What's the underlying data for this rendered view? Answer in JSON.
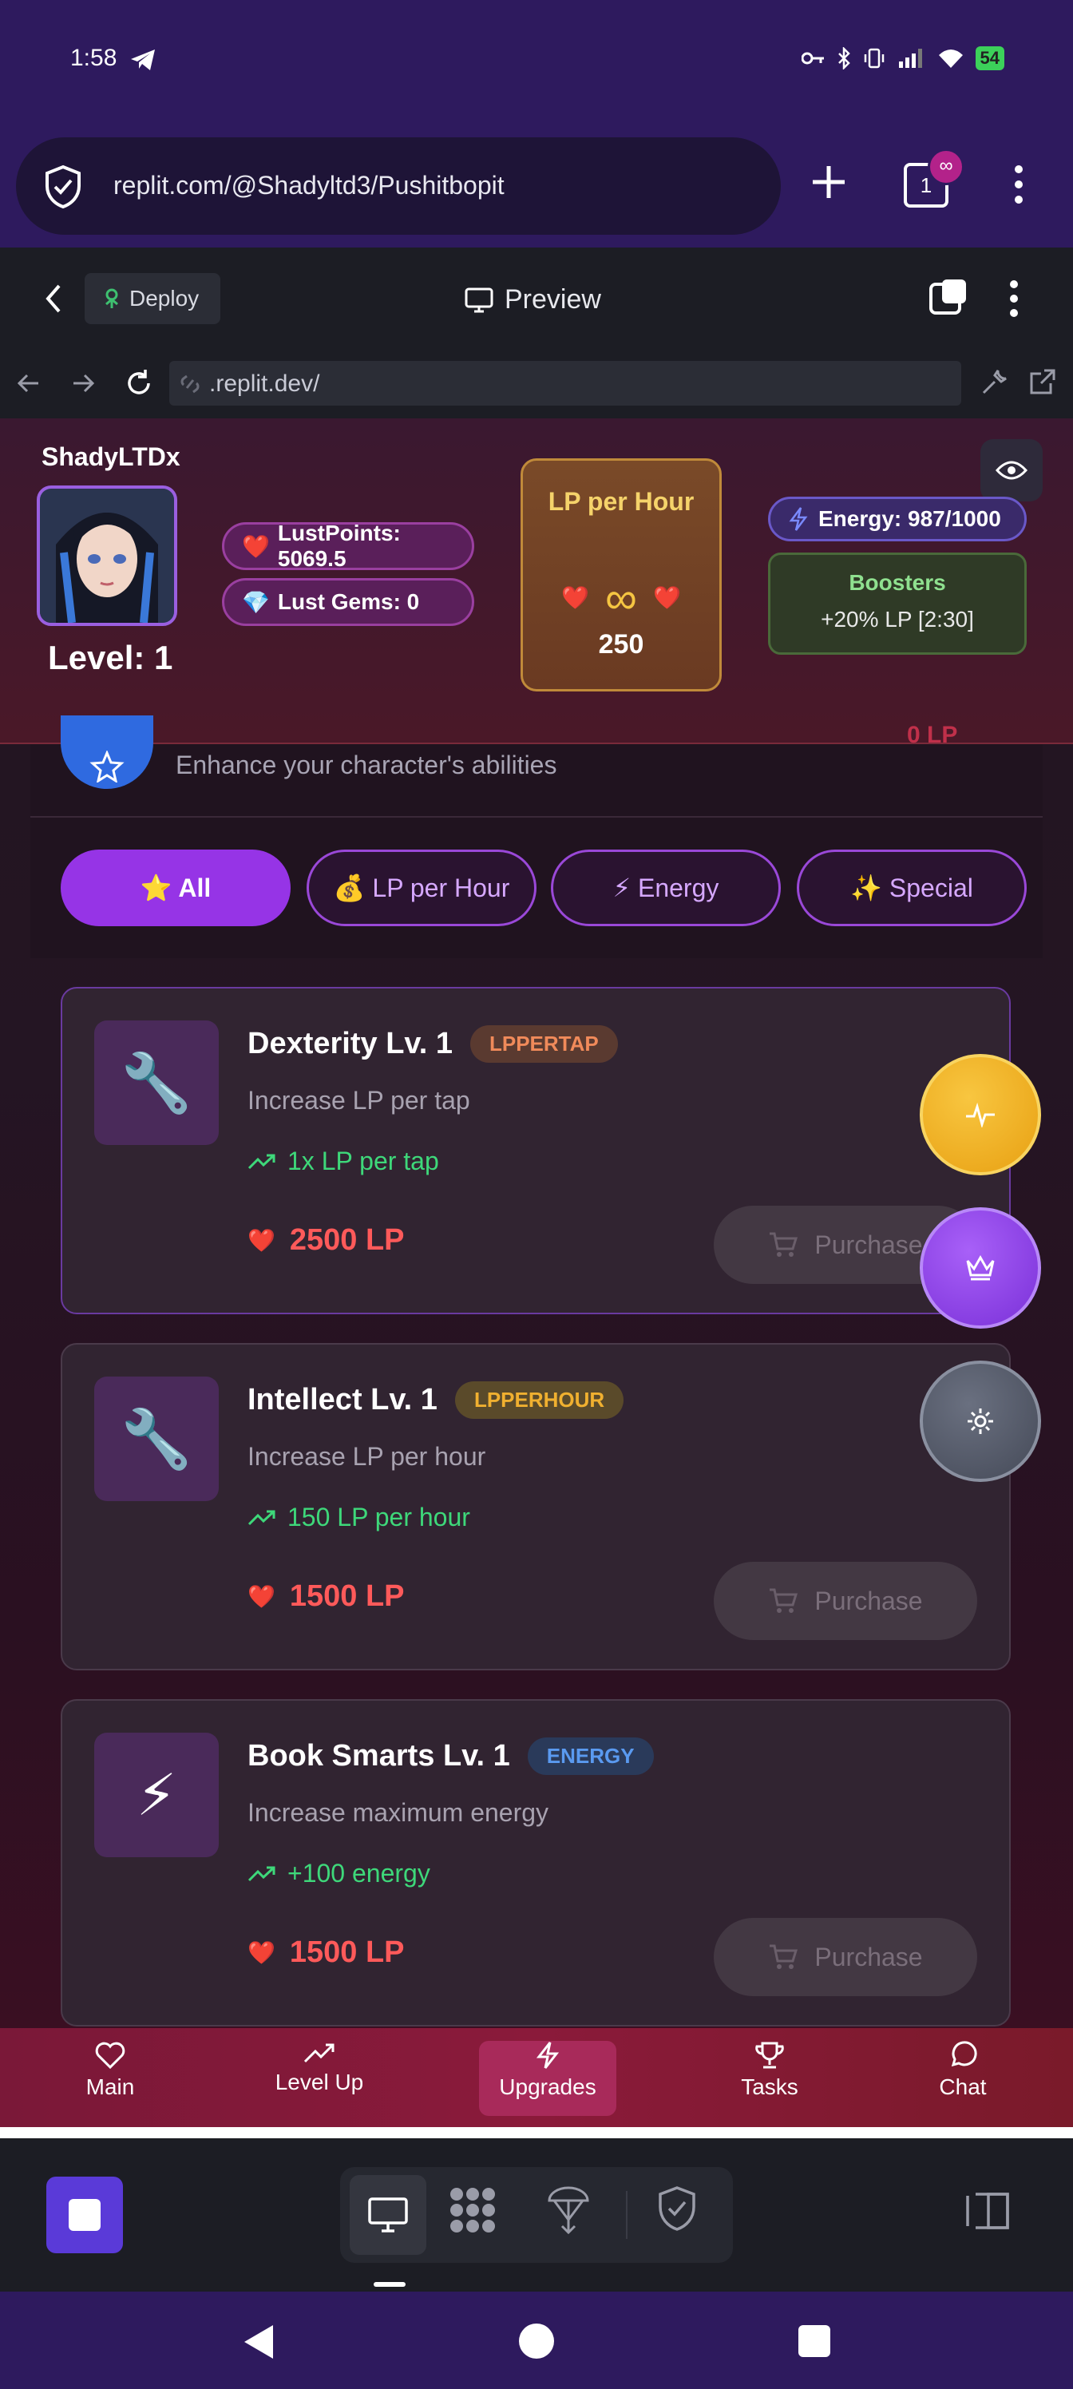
{
  "status_bar": {
    "time": "1:58",
    "battery": "54"
  },
  "browser": {
    "url": "replit.com/@Shadyltd3/Pushitbopit",
    "tab_count": "1",
    "tab_badge": "∞"
  },
  "replit_header": {
    "deploy_label": "Deploy",
    "preview_label": "Preview",
    "address": ".replit.dev/"
  },
  "player": {
    "username": "ShadyLTDx",
    "level": "Level: 1",
    "lust_points": "LustPoints: 5069.5",
    "lust_gems": "Lust Gems: 0",
    "energy": "Energy: 987/1000"
  },
  "lp_per_hour": {
    "title": "LP per Hour",
    "symbol": "∞",
    "value": "250"
  },
  "boosters": {
    "title": "Boosters",
    "value": "+20% LP [2:30]"
  },
  "panel": {
    "subtitle": "Enhance your character's abilities",
    "right": "0 LP"
  },
  "filters": [
    {
      "label": "⭐ All"
    },
    {
      "label": "💰 LP per Hour"
    },
    {
      "label": "⚡ Energy"
    },
    {
      "label": "✨ Special"
    }
  ],
  "upgrades": [
    {
      "icon": "🔧",
      "title": "Dexterity Lv. 1",
      "tag": "LPPERTAP",
      "desc": "Increase LP per tap",
      "effect": "1x LP per tap",
      "price": "2500 LP",
      "button": "Purchase"
    },
    {
      "icon": "🔧",
      "title": "Intellect Lv. 1",
      "tag": "LPPERHOUR",
      "desc": "Increase LP per hour",
      "effect": "150 LP per hour",
      "price": "1500 LP",
      "button": "Purchase"
    },
    {
      "icon": "⚡",
      "title": "Book Smarts Lv. 1",
      "tag": "ENERGY",
      "desc": "Increase maximum energy",
      "effect": "+100 energy",
      "price": "1500 LP",
      "button": "Purchase"
    }
  ],
  "nav": {
    "main": "Main",
    "levelup": "Level Up",
    "upgrades": "Upgrades",
    "tasks": "Tasks",
    "chat": "Chat"
  },
  "colors": {
    "accent_purple": "#9634e6",
    "price_red": "#ff5a5a",
    "effect_green": "#3ed87a",
    "lph_gold": "#f5d36a"
  }
}
